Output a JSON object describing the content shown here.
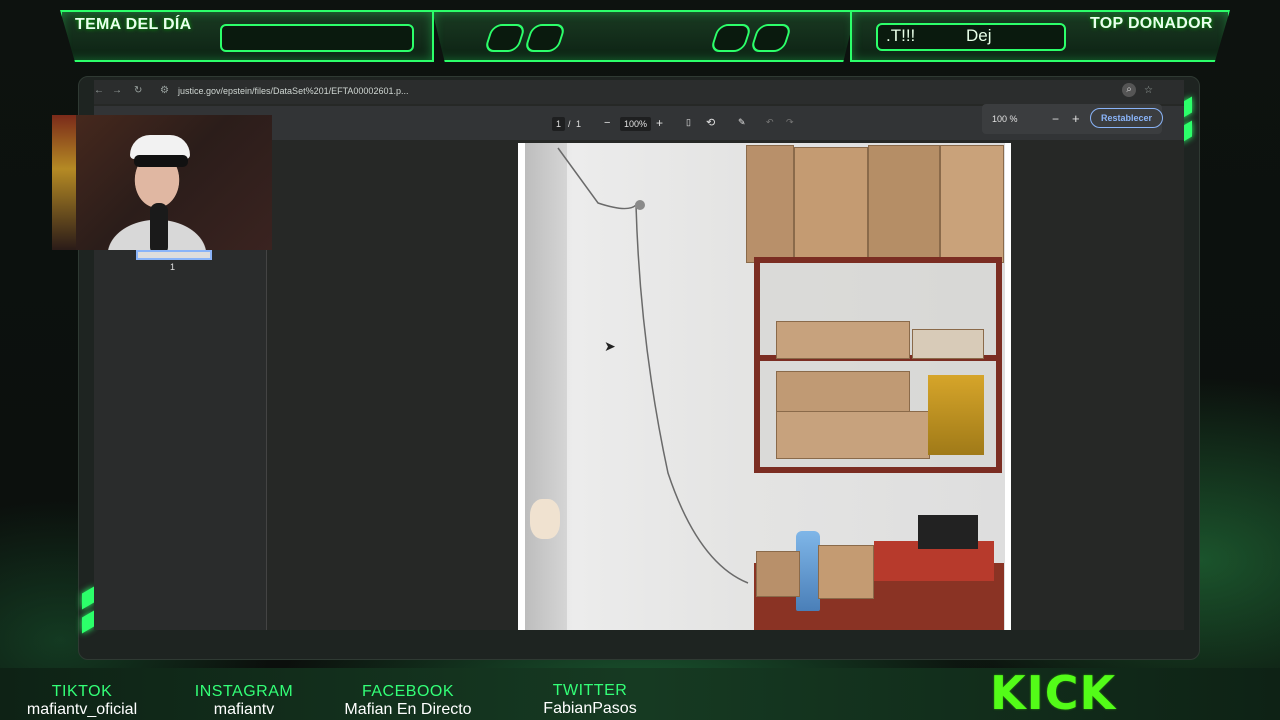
{
  "overlay": {
    "top_left_title": "TEMA DEL DÍA",
    "top_right_title": "TOP DONADOR",
    "top_right_text_1": ".T!!!",
    "top_right_text_2": "Dej"
  },
  "browser": {
    "url": "justice.gov/epstein/files/DataSet%201/EFTA00002601.p...",
    "back_icon": "arrow-left",
    "forward_icon": "arrow-right",
    "reload_icon": "reload",
    "zoom_search_icon": "magnifier",
    "bookmark_icon": "star"
  },
  "pdf_toolbar": {
    "page_current": "1",
    "page_sep": "/",
    "page_total": "1",
    "zoom_minus": "−",
    "zoom_value": "100%",
    "zoom_plus": "+",
    "zoom_popup_value": "100 %",
    "zoom_popup_minus": "−",
    "zoom_popup_plus": "+",
    "reset_label": "Restablecer"
  },
  "thumbnail": {
    "page_number": "1"
  },
  "socials": [
    {
      "label": "TIKTOK",
      "value": "mafiantv_oficial"
    },
    {
      "label": "INSTAGRAM",
      "value": "mafiantv"
    },
    {
      "label": "FACEBOOK",
      "value": "Mafian En Directo"
    },
    {
      "label": "TWITTER",
      "value": "FabianPasos"
    }
  ],
  "brand": {
    "kick_label": "KICK",
    "accent_color": "#2cff6a",
    "kick_color": "#53fc18"
  }
}
